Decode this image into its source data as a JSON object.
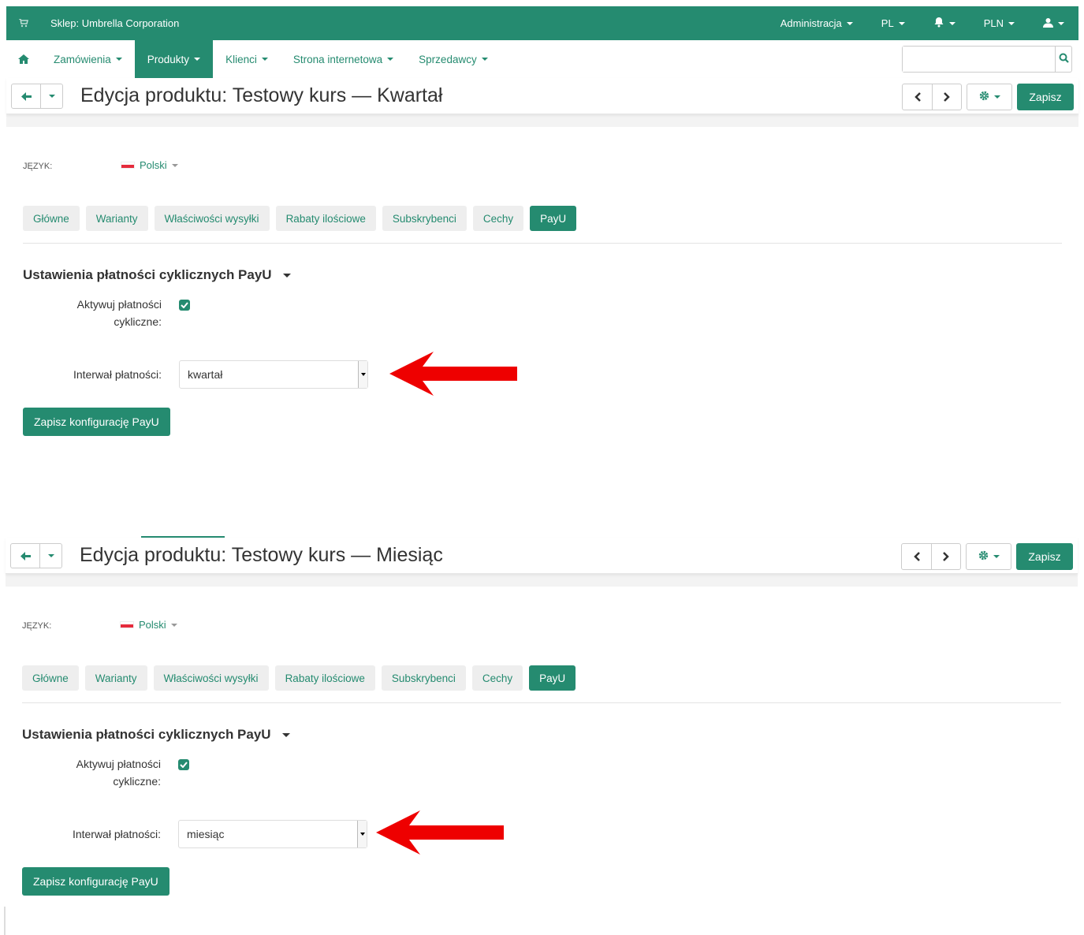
{
  "topbar": {
    "shop_label": "Sklep: Umbrella Corporation",
    "admin": "Administracja",
    "lang": "PL",
    "currency": "PLN",
    "bell_icon": "bell-icon",
    "user_icon": "user-icon",
    "cart_icon": "cart-icon"
  },
  "nav": {
    "home_icon": "home-icon",
    "items": [
      "Zamówienia",
      "Produkty",
      "Klienci",
      "Strona internetowa",
      "Sprzedawcy"
    ],
    "active": "Produkty",
    "search_placeholder": ""
  },
  "colors": {
    "brand": "#258b70",
    "arrow": "#ee0000"
  },
  "sections": [
    {
      "title": "Edycja produktu: Testowy kurs — Kwartał",
      "save": "Zapisz",
      "lang_label": "JĘZYK:",
      "lang_value": "Polski",
      "tabs": [
        "Główne",
        "Warianty",
        "Właściwości wysyłki",
        "Rabaty ilościowe",
        "Subskrybenci",
        "Cechy",
        "PayU"
      ],
      "active_tab": "PayU",
      "settings_title": "Ustawienia płatności cyklicznych PayU",
      "activate_label_1": "Aktywuj płatności",
      "activate_label_2": "cykliczne:",
      "activate_checked": true,
      "interval_label": "Interwał płatności:",
      "interval_value": "kwartał",
      "save_config": "Zapisz konfigurację PayU"
    },
    {
      "title": "Edycja produktu: Testowy kurs — Miesiąc",
      "save": "Zapisz",
      "lang_label": "JĘZYK:",
      "lang_value": "Polski",
      "tabs": [
        "Główne",
        "Warianty",
        "Właściwości wysyłki",
        "Rabaty ilościowe",
        "Subskrybenci",
        "Cechy",
        "PayU"
      ],
      "active_tab": "PayU",
      "settings_title": "Ustawienia płatności cyklicznych PayU",
      "activate_label_1": "Aktywuj płatności",
      "activate_label_2": "cykliczne:",
      "activate_checked": true,
      "interval_label": "Interwał płatności:",
      "interval_value": "miesiąc",
      "save_config": "Zapisz konfigurację PayU"
    }
  ]
}
